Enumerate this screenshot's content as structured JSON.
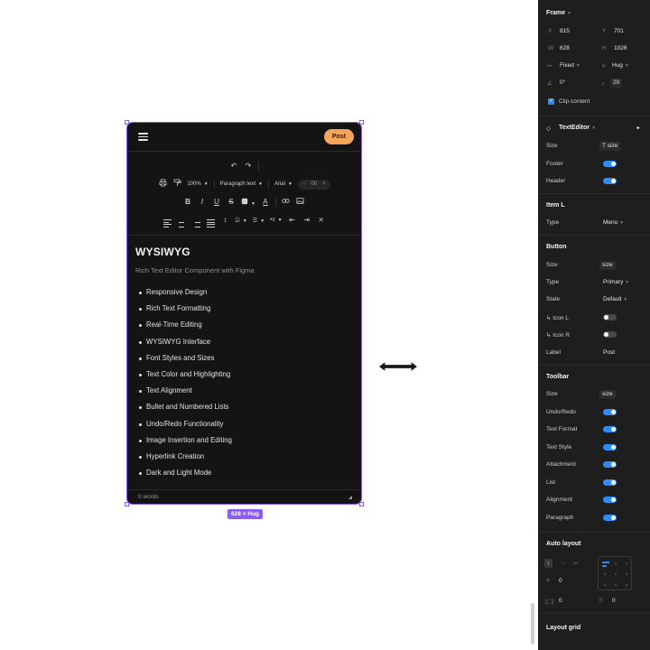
{
  "canvas": {
    "size_badge": "628 × Hug"
  },
  "editor": {
    "post_label": "Post",
    "toolbar": {
      "zoom": "100%",
      "paragraph_style": "Paragraph text",
      "font": "Arial",
      "font_size": "00",
      "bold": "B",
      "italic": "I",
      "underline": "U",
      "strike": "S",
      "text_color": "A"
    },
    "title": "WYSIWYG",
    "subtitle": "Rich Text Editor Component with Figma",
    "list": [
      "Responsive Design",
      "Rich Text Formatting",
      "Real-Time Editing",
      "WYSIWYG Interface",
      "Font Styles and Sizes",
      "Text Color and Highlighting",
      "Text Alignment",
      "Bullet and Numbered Lists",
      "Undo/Redo Functionality",
      "Image Insertion and Editing",
      "Hyperlink Creation",
      "Dark and Light Mode"
    ],
    "word_count": "0 words"
  },
  "panel": {
    "frame": {
      "title": "Frame",
      "x_label": "X",
      "x_value": "815",
      "y_label": "Y",
      "y_value": "701",
      "w_label": "W",
      "w_value": "628",
      "h_label": "H",
      "h_value": "1026",
      "width_mode": "Fixed",
      "height_mode": "Hug",
      "rotation": "0°",
      "radius": "20",
      "clip_label": "Clip content"
    },
    "component": {
      "name": "TextEditor",
      "size_label": "Size",
      "size_value": "size",
      "footer_label": "Footer",
      "header_label": "Header"
    },
    "item": {
      "title": "Item L",
      "type_label": "Type",
      "type_value": "Menu"
    },
    "button": {
      "title": "Button",
      "size_label": "Size",
      "size_value": "size",
      "type_label": "Type",
      "type_value": "Primary",
      "state_label": "State",
      "state_value": "Default",
      "icon_l_label": "↳ Icon L",
      "icon_r_label": "↳ Icon R",
      "label_label": "Label",
      "label_value": "Post"
    },
    "toolbar": {
      "title": "Toolbar",
      "size_label": "Size",
      "size_value": "size",
      "undo_redo": "Undo/Redo",
      "text_format": "Text Format",
      "text_style": "Text Style",
      "attachment": "Attachment",
      "list": "List",
      "alignment": "Alignment",
      "paragraph": "Paragraph"
    },
    "auto_layout": {
      "title": "Auto layout",
      "gap": "0",
      "padding_h": "0",
      "padding_v": "0"
    },
    "layout_grid": "Layout grid"
  },
  "colors": {
    "accent": "#8a5cf6",
    "post_button": "#f5a55a",
    "toggle_on": "#2f8cf6",
    "panel_bg": "#1e1e1e",
    "editor_bg": "#141414"
  }
}
